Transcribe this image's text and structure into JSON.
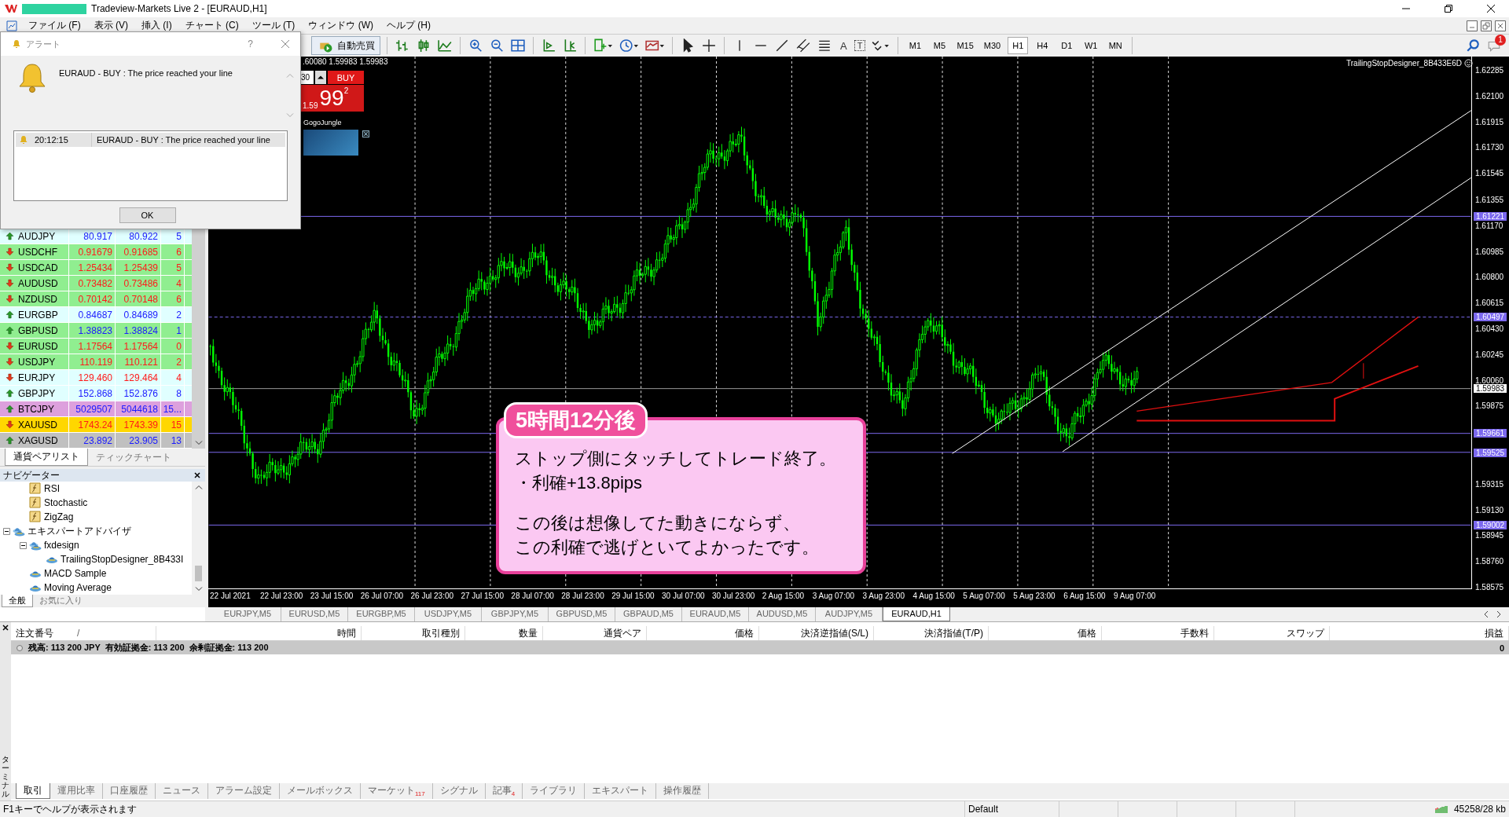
{
  "window": {
    "title": "Tradeview-Markets Live 2 - [EURAUD,H1]"
  },
  "menu": [
    "ファイル (F)",
    "表示 (V)",
    "挿入 (I)",
    "チャート (C)",
    "ツール (T)",
    "ウィンドウ (W)",
    "ヘルプ (H)"
  ],
  "toolbar": {
    "auto_trading": "自動売買",
    "text_tools": [
      "A",
      "T"
    ],
    "timeframes": [
      {
        "label": "M1",
        "selected": false
      },
      {
        "label": "M5",
        "selected": false
      },
      {
        "label": "M15",
        "selected": false
      },
      {
        "label": "M30",
        "selected": false
      },
      {
        "label": "H1",
        "selected": true
      },
      {
        "label": "H4",
        "selected": false
      },
      {
        "label": "D1",
        "selected": false
      },
      {
        "label": "W1",
        "selected": false
      },
      {
        "label": "MN",
        "selected": false
      }
    ],
    "notification_count": "1"
  },
  "alert": {
    "title": "アラート",
    "help": "?",
    "message": "EURAUD - BUY : The price reached your line",
    "log": [
      {
        "time": "20:12:15",
        "message": "EURAUD - BUY : The price reached your line"
      }
    ],
    "ok": "OK"
  },
  "market_watch": {
    "rows": [
      {
        "symbol": "AUDJPY",
        "bid": "80.917",
        "ask": "80.922",
        "spread": "5",
        "rising": true,
        "color": "#e0ffff"
      },
      {
        "symbol": "USDCHF",
        "bid": "0.91679",
        "ask": "0.91685",
        "spread": "6",
        "rising": false,
        "color": "#90ee90"
      },
      {
        "symbol": "USDCAD",
        "bid": "1.25434",
        "ask": "1.25439",
        "spread": "5",
        "rising": false,
        "color": "#90ee90"
      },
      {
        "symbol": "AUDUSD",
        "bid": "0.73482",
        "ask": "0.73486",
        "spread": "4",
        "rising": false,
        "color": "#90ee90"
      },
      {
        "symbol": "NZDUSD",
        "bid": "0.70142",
        "ask": "0.70148",
        "spread": "6",
        "rising": false,
        "color": "#90ee90"
      },
      {
        "symbol": "EURGBP",
        "bid": "0.84687",
        "ask": "0.84689",
        "spread": "2",
        "rising": true,
        "color": "#e0ffff"
      },
      {
        "symbol": "GBPUSD",
        "bid": "1.38823",
        "ask": "1.38824",
        "spread": "1",
        "rising": true,
        "color": "#90ee90"
      },
      {
        "symbol": "EURUSD",
        "bid": "1.17564",
        "ask": "1.17564",
        "spread": "0",
        "rising": false,
        "color": "#90ee90"
      },
      {
        "symbol": "USDJPY",
        "bid": "110.119",
        "ask": "110.121",
        "spread": "2",
        "rising": false,
        "color": "#90ee90"
      },
      {
        "symbol": "EURJPY",
        "bid": "129.460",
        "ask": "129.464",
        "spread": "4",
        "rising": false,
        "color": "#e0ffff"
      },
      {
        "symbol": "GBPJPY",
        "bid": "152.868",
        "ask": "152.876",
        "spread": "8",
        "rising": true,
        "color": "#e0ffff"
      },
      {
        "symbol": "BTCJPY",
        "bid": "5029507",
        "ask": "5044618",
        "spread": "15...",
        "rising": true,
        "color": "#dda0dd"
      },
      {
        "symbol": "XAUUSD",
        "bid": "1743.24",
        "ask": "1743.39",
        "spread": "15",
        "rising": false,
        "color": "#ffd700"
      },
      {
        "symbol": "XAGUSD",
        "bid": "23.892",
        "ask": "23.905",
        "spread": "13",
        "rising": true,
        "color": "#c0c0c0"
      }
    ],
    "tabs": [
      {
        "label": "通貨ペアリスト",
        "selected": true
      },
      {
        "label": "ティックチャート",
        "selected": false
      }
    ]
  },
  "navigator": {
    "title": "ナビゲーター",
    "tree": [
      {
        "label": "RSI",
        "kind": "indicator"
      },
      {
        "label": "Stochastic",
        "kind": "indicator"
      },
      {
        "label": "ZigZag",
        "kind": "indicator"
      },
      {
        "label": "エキスパートアドバイザ",
        "kind": "folder",
        "expanded": true,
        "children": [
          {
            "label": "fxdesign",
            "kind": "folder",
            "expanded": true,
            "children": [
              {
                "label": "TrailingStopDesigner_8B433I",
                "kind": "expert"
              }
            ]
          },
          {
            "label": "MACD Sample",
            "kind": "expert"
          },
          {
            "label": "Moving Average",
            "kind": "expert"
          }
        ]
      }
    ],
    "tabs": [
      {
        "label": "全般",
        "selected": true
      },
      {
        "label": "お気に入り",
        "selected": false
      }
    ]
  },
  "chart": {
    "quote_line": ".60080 1.59983 1.59983",
    "one_click": {
      "lot": "30",
      "buy": "BUY",
      "price_prefix": "1.59",
      "price_big": "99",
      "price_sup": "2"
    },
    "ad_label": "GogoJungle",
    "expert_name": "TrailingStopDesigner_8B433E6D",
    "price_ticks": [
      "1.62285",
      "1.62100",
      "1.61915",
      "1.61730",
      "1.61545",
      "1.61355",
      "1.61170",
      "1.60985",
      "1.60800",
      "1.60615",
      "1.60430",
      "1.60245",
      "1.60060",
      "1.59875",
      "1.59315",
      "1.59130",
      "1.58945",
      "1.58760",
      "1.58575"
    ],
    "levels": [
      {
        "label": "1.61221",
        "color": "#7b68ee",
        "kind": "solid"
      },
      {
        "label": "1.60497",
        "color": "#7b68ee",
        "kind": "dashed"
      },
      {
        "label": "1.59983",
        "color": "#ffffff",
        "kind": "current"
      },
      {
        "label": "1.59661",
        "color": "#7b68ee",
        "kind": "solid"
      },
      {
        "label": "1.59525",
        "color": "#7b68ee",
        "kind": "solid"
      },
      {
        "label": "1.59002",
        "color": "#7b68ee",
        "kind": "solid"
      }
    ],
    "time_ticks": [
      "22 Jul 2021",
      "22 Jul 23:00",
      "23 Jul 15:00",
      "26 Jul 07:00",
      "26 Jul 23:00",
      "27 Jul 15:00",
      "28 Jul 07:00",
      "28 Jul 23:00",
      "29 Jul 15:00",
      "30 Jul 07:00",
      "30 Jul 23:00",
      "2 Aug 15:00",
      "3 Aug 07:00",
      "3 Aug 23:00",
      "4 Aug 15:00",
      "5 Aug 07:00",
      "5 Aug 23:00",
      "6 Aug 15:00",
      "9 Aug 07:00"
    ],
    "callout": {
      "title": "5時間12分後",
      "paragraphs": [
        [
          "ストップ側にタッチしてトレード終了。",
          "・利確+13.8pips"
        ],
        [
          "この後は想像してた動きにならず、",
          "この利確で逃げといてよかったです。"
        ]
      ]
    }
  },
  "chart_tabs": [
    {
      "label": "EURJPY,M5",
      "selected": false
    },
    {
      "label": "EURUSD,M5",
      "selected": false
    },
    {
      "label": "EURGBP,M5",
      "selected": false
    },
    {
      "label": "USDJPY,M5",
      "selected": false
    },
    {
      "label": "GBPJPY,M5",
      "selected": false
    },
    {
      "label": "GBPUSD,M5",
      "selected": false
    },
    {
      "label": "GBPAUD,M5",
      "selected": false
    },
    {
      "label": "EURAUD,M5",
      "selected": false
    },
    {
      "label": "AUDUSD,M5",
      "selected": false
    },
    {
      "label": "AUDJPY,M5",
      "selected": false
    },
    {
      "label": "EURAUD,H1",
      "selected": true
    }
  ],
  "terminal": {
    "side_label": "ターミナル",
    "sort_mark": "/",
    "columns": [
      "注文番号",
      "時間",
      "取引種別",
      "数量",
      "通貨ペア",
      "価格",
      "決済逆指値(S/L)",
      "決済指値(T/P)",
      "価格",
      "手数料",
      "スワップ",
      "損益"
    ],
    "balance": "残高: 113 200 JPY  有効証拠金: 113 200  余剰証拠金: 113 200",
    "balance_profit": "0",
    "tabs": [
      {
        "label": "取引",
        "selected": true
      },
      {
        "label": "運用比率",
        "selected": false
      },
      {
        "label": "口座履歴",
        "selected": false
      },
      {
        "label": "ニュース",
        "selected": false
      },
      {
        "label": "アラーム設定",
        "selected": false
      },
      {
        "label": "メールボックス",
        "selected": false
      },
      {
        "label": "マーケット",
        "badge": "117",
        "selected": false
      },
      {
        "label": "シグナル",
        "selected": false
      },
      {
        "label": "記事",
        "badge": "4",
        "selected": false
      },
      {
        "label": "ライブラリ",
        "selected": false
      },
      {
        "label": "エキスパート",
        "selected": false
      },
      {
        "label": "操作履歴",
        "selected": false
      }
    ]
  },
  "status_bar": {
    "help": "F1キーでヘルプが表示されます",
    "profile": "Default",
    "traffic": "45258/28 kb"
  }
}
